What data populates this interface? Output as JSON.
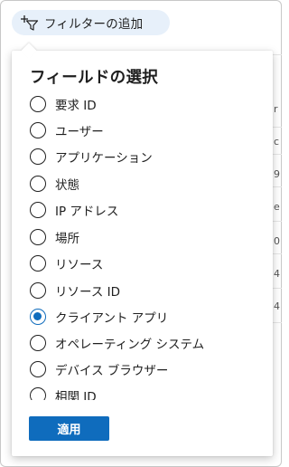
{
  "filter_button": {
    "label": "フィルターの追加",
    "icon": "add-filter-icon"
  },
  "panel": {
    "title": "フィールドの選択",
    "options": [
      {
        "label": "要求 ID",
        "checked": false
      },
      {
        "label": "ユーザー",
        "checked": false
      },
      {
        "label": "アプリケーション",
        "checked": false
      },
      {
        "label": "状態",
        "checked": false
      },
      {
        "label": "IP アドレス",
        "checked": false
      },
      {
        "label": "場所",
        "checked": false
      },
      {
        "label": "リソース",
        "checked": false
      },
      {
        "label": "リソース ID",
        "checked": false
      },
      {
        "label": "クライアント アプリ",
        "checked": true
      },
      {
        "label": "オペレーティング システム",
        "checked": false
      },
      {
        "label": "デバイス ブラウザー",
        "checked": false
      },
      {
        "label": "相関 ID",
        "checked": false
      }
    ],
    "apply_label": "適用"
  },
  "background_fragments": [
    "r",
    "c",
    "9",
    "e",
    "0",
    "4",
    "4"
  ],
  "colors": {
    "accent": "#0f6cbd",
    "pill_bg": "#e7f0fa"
  }
}
